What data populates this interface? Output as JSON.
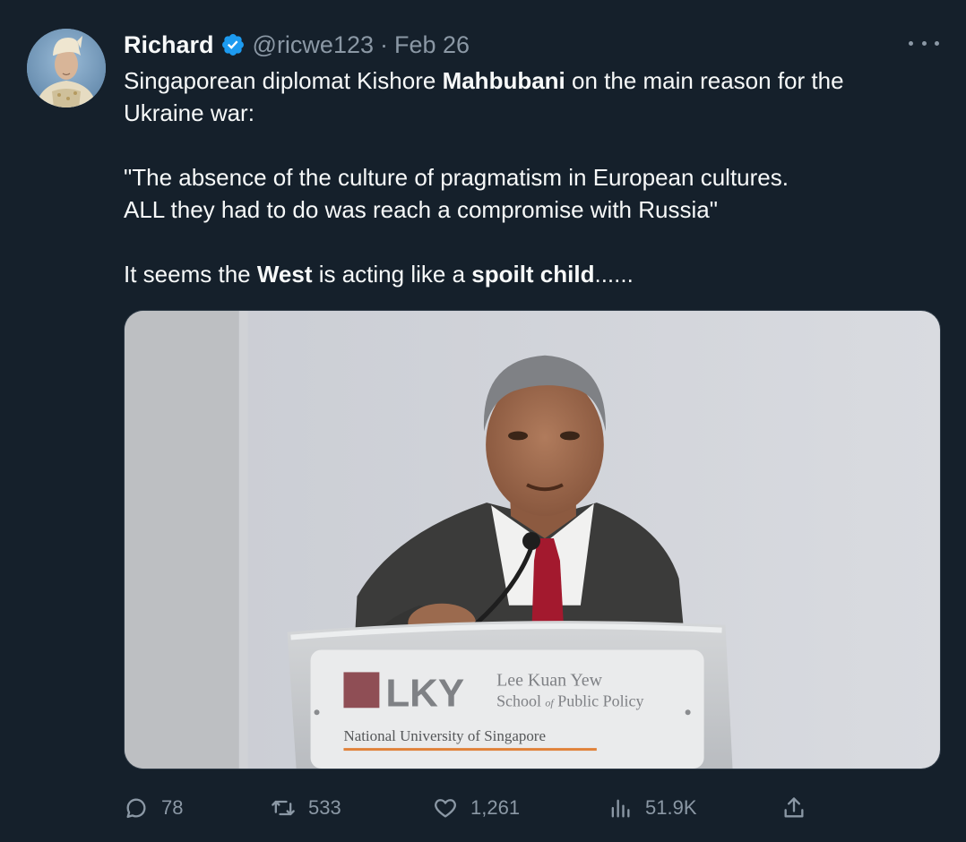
{
  "author": {
    "name": "Richard",
    "handle": "@ricwe123",
    "separator": "·",
    "date": "Feb 26",
    "verified": true,
    "avatar_icon": "portrait-avatar"
  },
  "tweet": {
    "line1_pre": "Singaporean diplomat Kishore ",
    "line1_bold": "Mahbubani",
    "line1_post": " on the main reason for the Ukraine war:",
    "quote_line1": "\"The absence of the culture of pragmatism in European cultures.",
    "quote_line2": "ALL they had to do was reach a compromise with Russia\"",
    "line3_pre": "It seems the ",
    "line3_bold1": "West",
    "line3_mid": " is acting like a ",
    "line3_bold2": "spoilt child",
    "line3_post": "......"
  },
  "media": {
    "podium_logo_text": "LKY",
    "podium_line1": "Lee Kuan Yew",
    "podium_line2_a": "School ",
    "podium_line2_of": "of",
    "podium_line2_b": " Public Policy",
    "podium_line3": "National University of Singapore"
  },
  "actions": {
    "replies": "78",
    "retweets": "533",
    "likes": "1,261",
    "views": "51.9K"
  },
  "colors": {
    "background": "#15202b",
    "verified_blue": "#1d9bf0",
    "muted": "#8b98a5"
  }
}
